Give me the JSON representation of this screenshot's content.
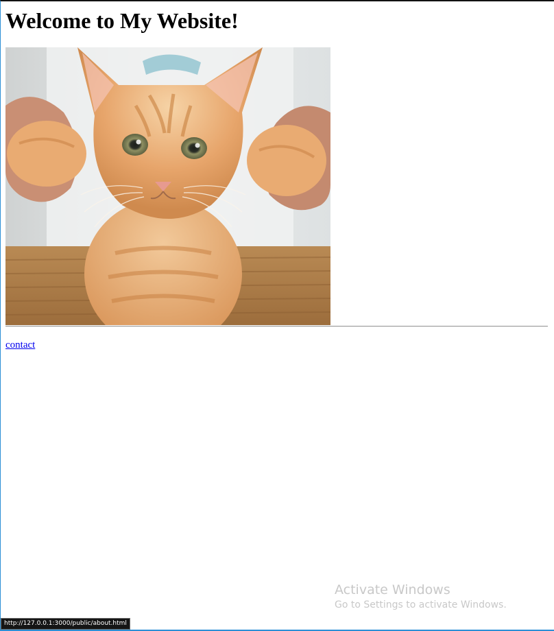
{
  "page": {
    "heading": "Welcome to My Website!",
    "image_alt": "orange tabby kitten held up by its paws",
    "link_contact": "contact"
  },
  "status_bar": {
    "url": "http://127.0.0.1:3000/public/about.html"
  },
  "watermark": {
    "title": "Activate Windows",
    "subtitle": "Go to Settings to activate Windows."
  },
  "colors": {
    "link": "#0000ee",
    "window_border": "#2b8fd6",
    "kitten": "#e7a56b"
  }
}
